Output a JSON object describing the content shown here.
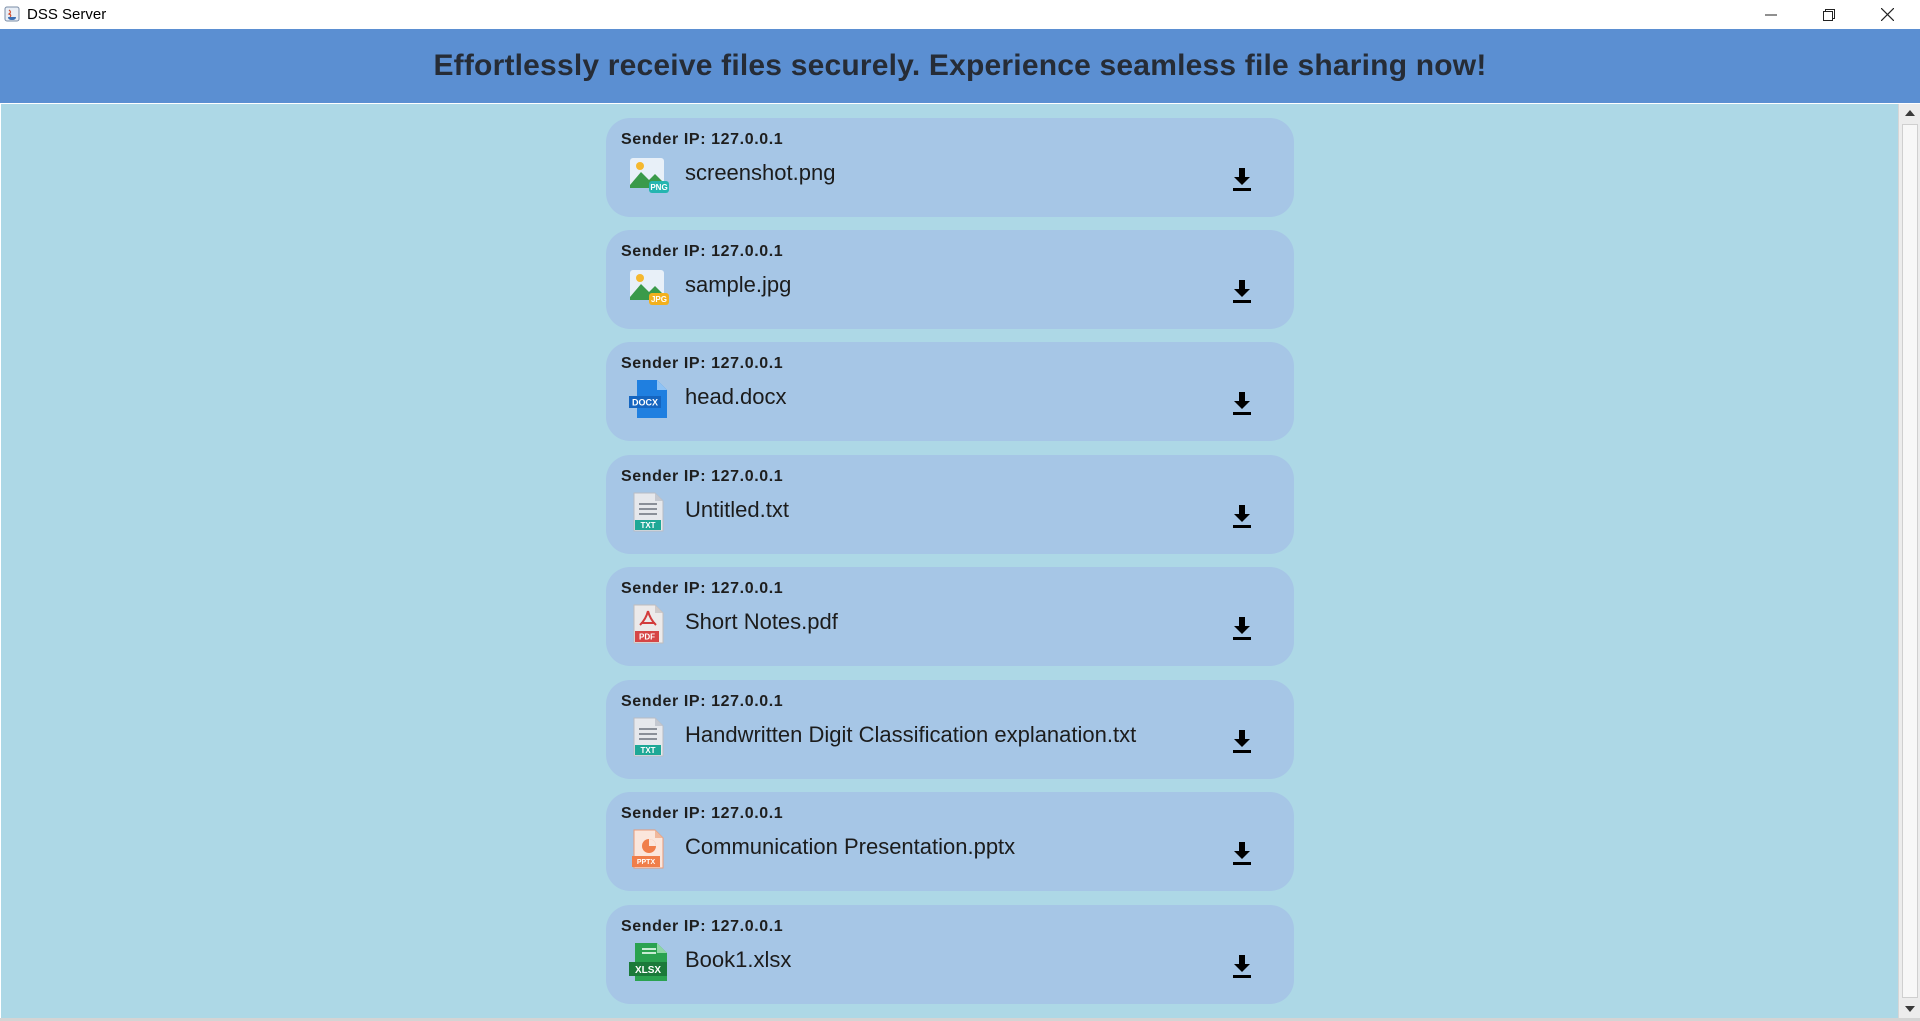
{
  "window": {
    "title": "DSS Server"
  },
  "banner": {
    "text": "Effortlessly receive files securely. Experience seamless file sharing now!"
  },
  "colors": {
    "banner": "#5b8fd2",
    "content_bg": "#add8e6",
    "card_bg": "#a6c6e6"
  },
  "files": [
    {
      "sender": "Sender IP: 127.0.0.1",
      "name": "screenshot.png",
      "icon": "png-image-icon",
      "badge": "PNG"
    },
    {
      "sender": "Sender IP: 127.0.0.1",
      "name": "sample.jpg",
      "icon": "jpg-image-icon",
      "badge": "JPG"
    },
    {
      "sender": "Sender IP: 127.0.0.1",
      "name": "head.docx",
      "icon": "docx-file-icon",
      "badge": "DOCX"
    },
    {
      "sender": "Sender IP: 127.0.0.1",
      "name": "Untitled.txt",
      "icon": "txt-file-icon",
      "badge": "TXT"
    },
    {
      "sender": "Sender IP: 127.0.0.1",
      "name": "Short Notes.pdf",
      "icon": "pdf-file-icon",
      "badge": "PDF"
    },
    {
      "sender": "Sender IP: 127.0.0.1",
      "name": "Handwritten Digit Classification explanation.txt",
      "icon": "txt-file-icon",
      "badge": "TXT"
    },
    {
      "sender": "Sender IP: 127.0.0.1",
      "name": "Communication Presentation.pptx",
      "icon": "pptx-file-icon",
      "badge": "PPTX"
    },
    {
      "sender": "Sender IP: 127.0.0.1",
      "name": "Book1.xlsx",
      "icon": "xlsx-file-icon",
      "badge": "XLSX"
    }
  ]
}
